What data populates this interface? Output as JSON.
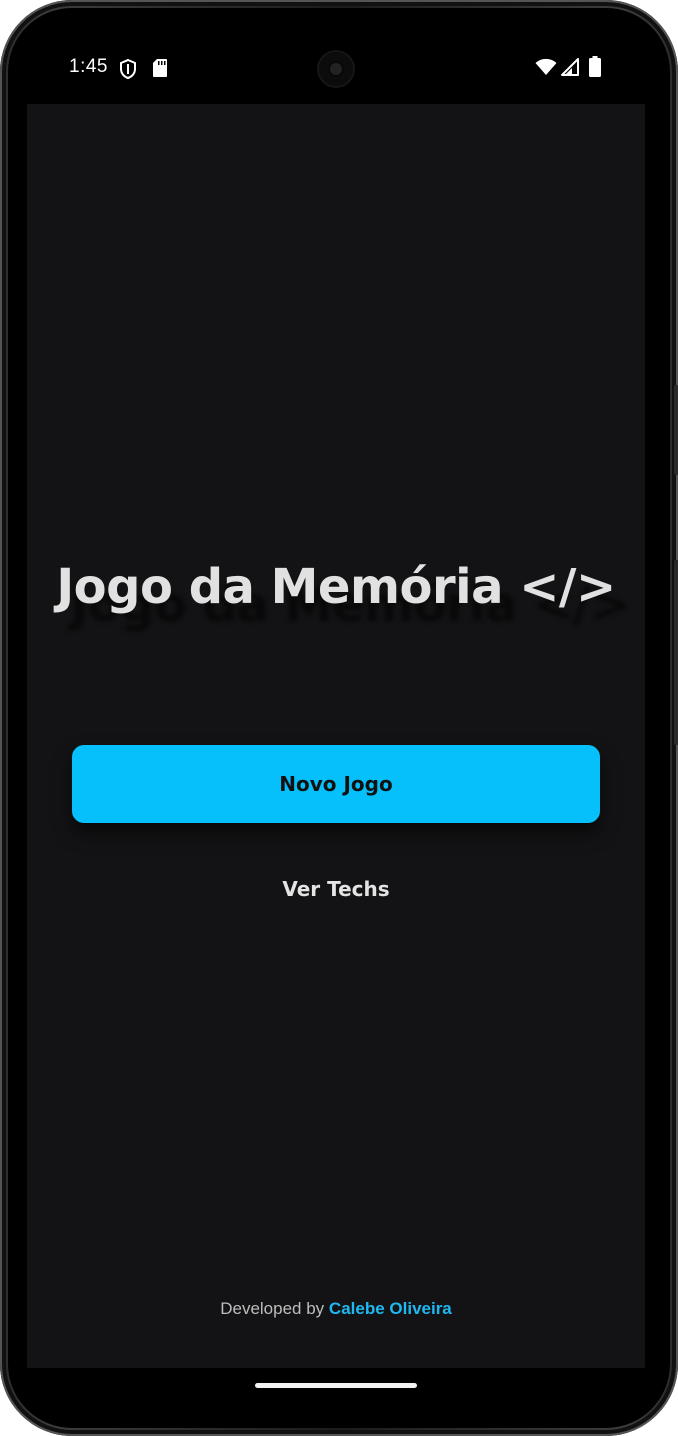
{
  "status_bar": {
    "time": "1:45",
    "icons": [
      "shield-icon",
      "sd-card-icon",
      "camera-icon",
      "wifi-icon",
      "signal-icon",
      "battery-icon"
    ]
  },
  "main": {
    "title": "Jogo da Memória </>",
    "new_game_label": "Novo Jogo",
    "view_techs_label": "Ver Techs"
  },
  "footer": {
    "prefix": "Developed by",
    "author": "Calebe Oliveira"
  },
  "colors": {
    "background": "#131315",
    "accent": "#05c0fb",
    "title_text": "#e1e1e1",
    "author_link": "#1fb8f0"
  }
}
